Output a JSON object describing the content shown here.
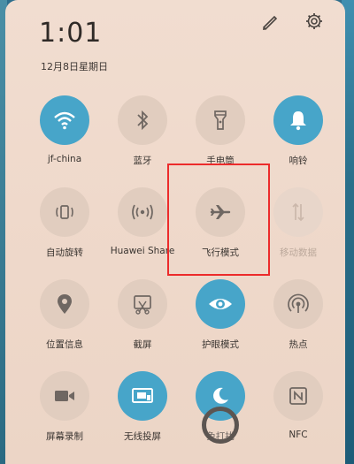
{
  "status": {
    "time": "1:01",
    "date": "12月8日星期日"
  },
  "header": {
    "edit_icon": "pencil-edit-icon",
    "settings_icon": "gear-icon"
  },
  "tiles": [
    {
      "label": "jf-china",
      "icon": "wifi-icon",
      "on": true
    },
    {
      "label": "蓝牙",
      "icon": "bluetooth-icon",
      "on": false
    },
    {
      "label": "手电筒",
      "icon": "flashlight-icon",
      "on": false
    },
    {
      "label": "响铃",
      "icon": "bell-icon",
      "on": true
    },
    {
      "label": "自动旋转",
      "icon": "auto-rotate-icon",
      "on": false
    },
    {
      "label": "Huawei Share",
      "icon": "huawei-share-icon",
      "on": false
    },
    {
      "label": "飞行模式",
      "icon": "airplane-icon",
      "on": false
    },
    {
      "label": "移动数据",
      "icon": "mobile-data-icon",
      "on": false,
      "dim": true
    },
    {
      "label": "位置信息",
      "icon": "location-pin-icon",
      "on": false
    },
    {
      "label": "截屏",
      "icon": "screenshot-icon",
      "on": false
    },
    {
      "label": "护眼模式",
      "icon": "eye-comfort-icon",
      "on": true
    },
    {
      "label": "热点",
      "icon": "hotspot-icon",
      "on": false
    },
    {
      "label": "屏幕录制",
      "icon": "screen-record-icon",
      "on": false
    },
    {
      "label": "无线投屏",
      "icon": "wireless-projection-icon",
      "on": true
    },
    {
      "label": "免打扰",
      "icon": "moon-icon",
      "on": true
    },
    {
      "label": "NFC",
      "icon": "nfc-icon",
      "on": false
    }
  ],
  "colors": {
    "active": "#47a5c9",
    "inactive": "#e1cdbf",
    "highlight": "#ec2b2b"
  }
}
